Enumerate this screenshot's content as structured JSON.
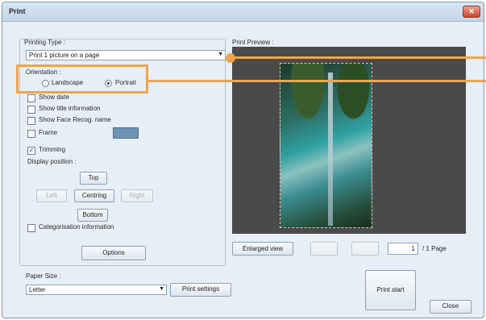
{
  "window": {
    "title": "Print",
    "close_label": "✕"
  },
  "printing_type": {
    "label": "Printing Type :",
    "selected": "Print 1 picture on a page",
    "dropdown_icon": "chevron-down-icon"
  },
  "orientation": {
    "label": "Orientation :",
    "landscape": "Landscape",
    "portrait": "Portrait",
    "selected": "Portrait"
  },
  "options": {
    "show_date": "Show date",
    "show_title": "Show title information",
    "show_face_recog": "Show Face Recog. name",
    "frame": "Frame",
    "trimming": "Trimming",
    "trimming_checked": true,
    "trimming_mark": "✓",
    "categorisation": "Categorisation information",
    "frame_color": "#6d94b5"
  },
  "display_position": {
    "label": "Display position :",
    "top": "Top",
    "left": "Left",
    "centring": "Centring",
    "right": "Right",
    "bottom": "Bottom"
  },
  "options_button": "Options",
  "preview": {
    "label": "Print Preview :",
    "enlarged_view": "Enlarged view",
    "current_page": "1",
    "total_pages": "/ 1 Page"
  },
  "paper_size": {
    "label": "Paper Size :",
    "selected": "Letter",
    "print_settings": "Print settings"
  },
  "print_start": "Print start",
  "close": "Close",
  "colors": {
    "callout": "#f0a44a",
    "window_bg": "#e9eff5",
    "preview_bg": "#4a4a4a"
  }
}
